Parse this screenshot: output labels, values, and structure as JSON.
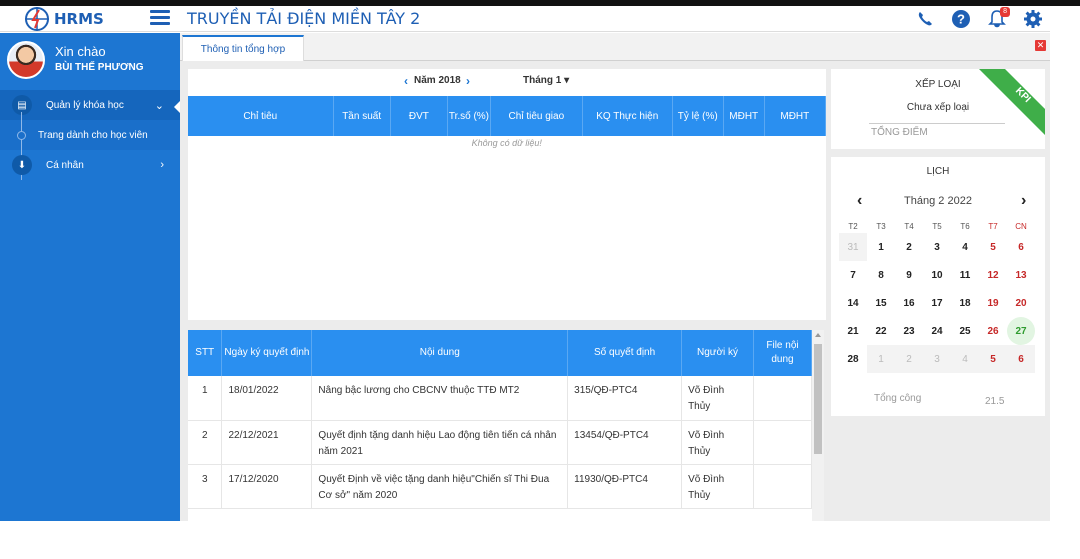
{
  "app": {
    "logo_text": "HRMS",
    "title": "TRUYỀN TẢI ĐIỆN MIỀN TÂY 2",
    "notification_count": "8"
  },
  "user": {
    "greeting": "Xin chào",
    "name": "BÙI THẾ PHƯƠNG"
  },
  "sidebar": {
    "items": [
      {
        "label": "Quản lý khóa học",
        "icon": "course-icon",
        "expanded": true
      },
      {
        "label": "Cá nhân",
        "icon": "person-icon",
        "expanded": false
      }
    ],
    "sub_items": [
      {
        "label": "Trang dành cho học viên"
      }
    ]
  },
  "tab": {
    "label": "Thông tin tổng hợp"
  },
  "kpi_table": {
    "year_label": "Năm 2018",
    "month_label": "Tháng 1",
    "columns": [
      "Chỉ tiêu",
      "Tần suất",
      "ĐVT",
      "Tr.số (%)",
      "Chỉ tiêu giao",
      "KQ Thực hiện",
      "Tỷ lệ (%)",
      "MĐHT",
      "MĐHT"
    ],
    "empty_text": "Không có dữ liệu!"
  },
  "decisions": {
    "columns": [
      "STT",
      "Ngày ký quyết định",
      "Nội dung",
      "Số quyết định",
      "Người ký",
      "File nội dung"
    ],
    "rows": [
      {
        "stt": "1",
        "date": "18/01/2022",
        "content": "Nâng bậc lương cho CBCNV thuộc TTĐ MT2",
        "number": "315/QĐ-PTC4",
        "signer": "Võ Đình Thủy",
        "file": ""
      },
      {
        "stt": "2",
        "date": "22/12/2021",
        "content": "Quyết định tặng danh hiệu Lao động tiên tiến cá nhân năm 2021",
        "number": "13454/QĐ-PTC4",
        "signer": "Võ Đình Thủy",
        "file": ""
      },
      {
        "stt": "3",
        "date": "17/12/2020",
        "content": "Quyết Định về việc tặng danh hiệu\"Chiến sĩ Thi Đua Cơ sở\" năm 2020",
        "number": "11930/QĐ-PTC4",
        "signer": "Võ Đình Thủy",
        "file": ""
      }
    ]
  },
  "rating": {
    "title": "XẾP LOẠI",
    "status": "Chưa xếp loại",
    "total_label": "TỔNG ĐIỂM",
    "ribbon": "KPI"
  },
  "calendar": {
    "title": "LỊCH",
    "month_label": "Tháng 2 2022",
    "weekdays": [
      "T2",
      "T3",
      "T4",
      "T5",
      "T6",
      "T7",
      "CN"
    ],
    "weeks": [
      [
        "31",
        "1",
        "2",
        "3",
        "4",
        "5",
        "6"
      ],
      [
        "7",
        "8",
        "9",
        "10",
        "11",
        "12",
        "13"
      ],
      [
        "14",
        "15",
        "16",
        "17",
        "18",
        "19",
        "20"
      ],
      [
        "21",
        "22",
        "23",
        "24",
        "25",
        "26",
        "27"
      ],
      [
        "28",
        "1",
        "2",
        "3",
        "4",
        "5",
        "6"
      ]
    ],
    "today": "27",
    "total_label": "Tổng công",
    "total_value": "21.5"
  },
  "colors": {
    "primary": "#1d76d2",
    "header": "#2a8ff0",
    "weekend": "#c62828",
    "today": "#2e9b2e",
    "ribbon": "#3fae49"
  }
}
